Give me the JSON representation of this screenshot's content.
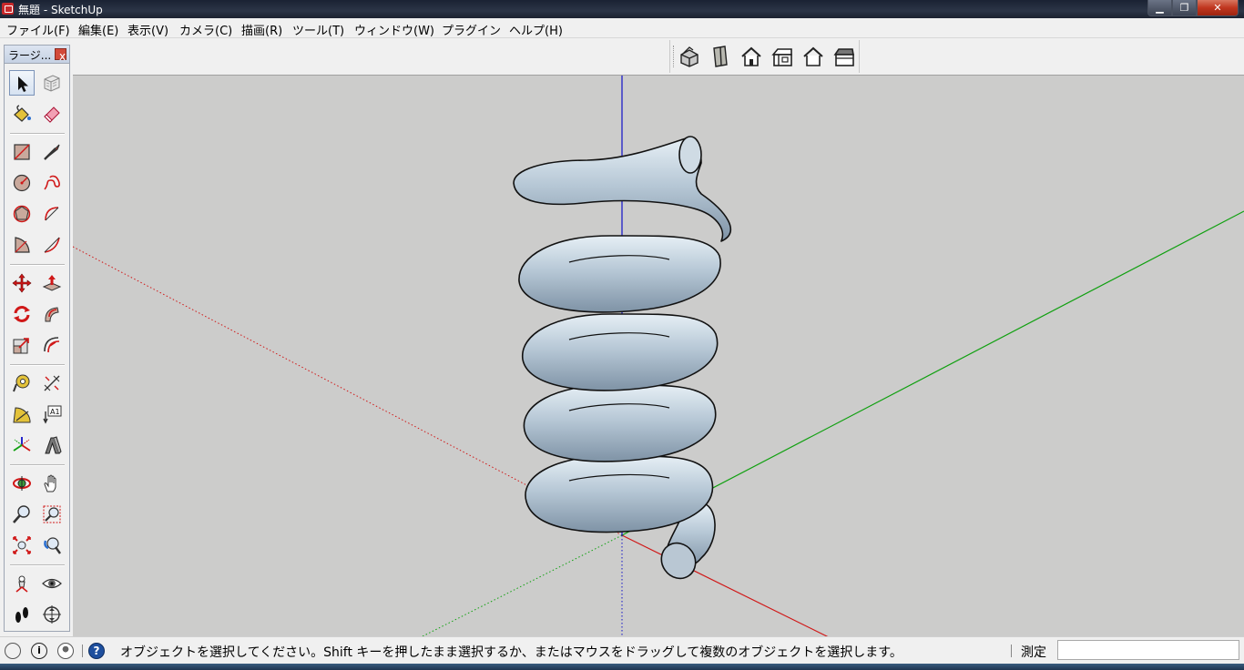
{
  "window": {
    "title": "無題 - SketchUp",
    "minimize_icon": "minimize-icon",
    "maximize_icon": "restore-icon",
    "close_icon": "close-icon",
    "minimize_glyph": "▁",
    "maximize_glyph": "❐",
    "close_glyph": "✕"
  },
  "menu": {
    "items": [
      {
        "label": "ファイル(F)"
      },
      {
        "label": "編集(E)"
      },
      {
        "label": "表示(V)"
      },
      {
        "label": "カメラ(C)"
      },
      {
        "label": "描画(R)"
      },
      {
        "label": "ツール(T)"
      },
      {
        "label": "ウィンドウ(W)"
      },
      {
        "label": "プラグイン"
      },
      {
        "label": "ヘルプ(H)"
      }
    ]
  },
  "views_toolbar": {
    "buttons": [
      {
        "icon": "iso-view-icon"
      },
      {
        "icon": "top-view-icon"
      },
      {
        "icon": "front-view-icon"
      },
      {
        "icon": "right-view-icon"
      },
      {
        "icon": "back-view-icon"
      },
      {
        "icon": "left-view-icon"
      }
    ]
  },
  "toolset": {
    "title": "ラージ...",
    "close_glyph": "x",
    "tools": [
      {
        "icon": "select-icon"
      },
      {
        "icon": "make-component-icon"
      },
      {
        "icon": "paint-bucket-icon"
      },
      {
        "icon": "eraser-icon"
      },
      {
        "icon": "rectangle-icon"
      },
      {
        "icon": "line-icon"
      },
      {
        "icon": "circle-icon"
      },
      {
        "icon": "freehand-icon"
      },
      {
        "icon": "polygon-icon"
      },
      {
        "icon": "arc-icon"
      },
      {
        "icon": "pie-icon"
      },
      {
        "icon": "two-point-arc-icon"
      },
      {
        "icon": "move-icon"
      },
      {
        "icon": "push-pull-icon"
      },
      {
        "icon": "rotate-icon"
      },
      {
        "icon": "follow-me-icon"
      },
      {
        "icon": "scale-icon"
      },
      {
        "icon": "offset-icon"
      },
      {
        "icon": "tape-measure-icon"
      },
      {
        "icon": "dimension-icon"
      },
      {
        "icon": "protractor-icon"
      },
      {
        "icon": "text-icon"
      },
      {
        "icon": "axes-icon"
      },
      {
        "icon": "3d-text-icon"
      },
      {
        "icon": "orbit-icon"
      },
      {
        "icon": "pan-icon"
      },
      {
        "icon": "zoom-icon"
      },
      {
        "icon": "zoom-window-icon"
      },
      {
        "icon": "zoom-extents-icon"
      },
      {
        "icon": "previous-view-icon"
      },
      {
        "icon": "position-camera-icon"
      },
      {
        "icon": "look-around-icon"
      },
      {
        "icon": "walk-icon"
      },
      {
        "icon": "section-plane-icon"
      }
    ]
  },
  "status": {
    "geo_icon": "geo-location-icon",
    "credits_icon": "credits-icon",
    "user_icon": "user-icon",
    "help_icon": "help-icon",
    "help_glyph": "?",
    "message": "オブジェクトを選択してください。Shift キーを押したまま選択するか、またはマウスをドラッグして複数のオブジェクトを選択します。",
    "measure_label": "測定",
    "measure_value": ""
  },
  "colors": {
    "viewport_background": "#cccccb",
    "red_axis": "#d01818",
    "green_axis": "#10a010",
    "blue_axis": "#1010c8",
    "coil_face": "#a9bccb",
    "coil_edge": "#111111"
  }
}
